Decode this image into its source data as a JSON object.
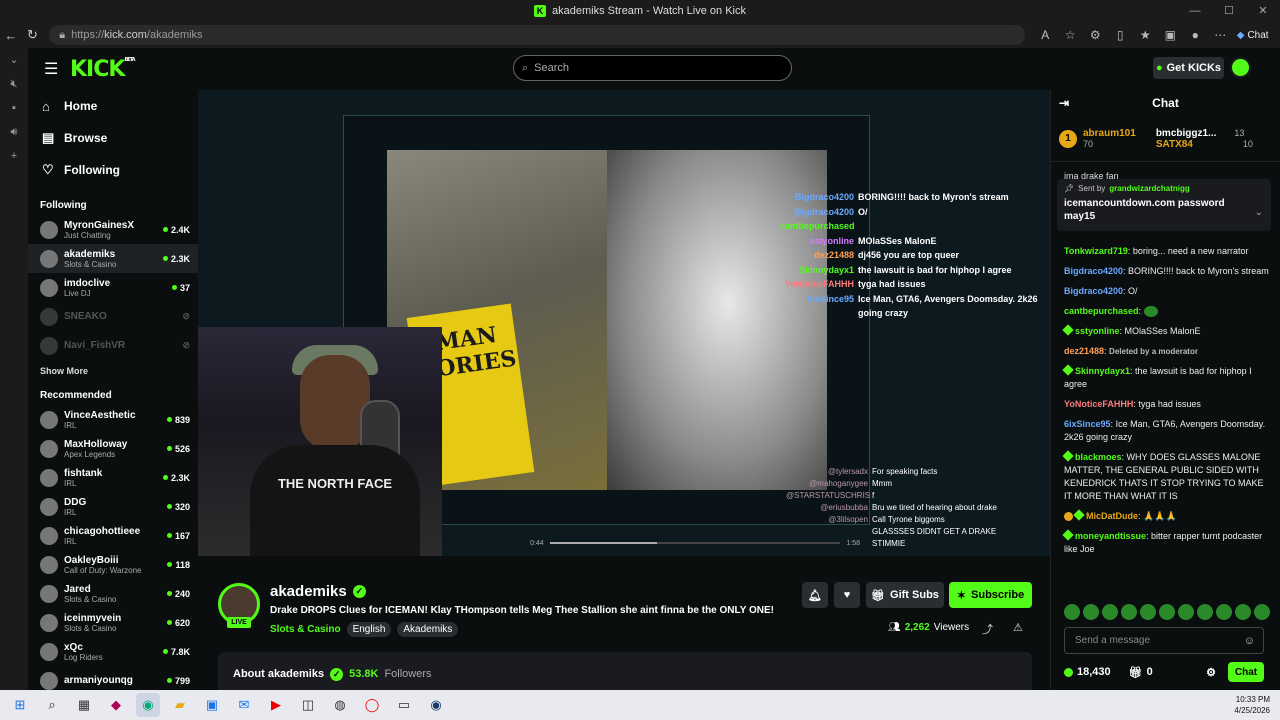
{
  "window": {
    "title": "akademiks Stream - Watch Live on Kick"
  },
  "browser": {
    "url_prefix": "https://",
    "url_domain": "kick.com",
    "url_path": "/akademiks",
    "copilot_label": "Chat"
  },
  "header": {
    "logo": "KICK",
    "logo_badge": "BETA",
    "search_placeholder": "Search",
    "get_kicks_label": "Get KICKs"
  },
  "sidebar": {
    "nav": [
      {
        "label": "Home",
        "icon": "home-icon"
      },
      {
        "label": "Browse",
        "icon": "browse-icon"
      },
      {
        "label": "Following",
        "icon": "heart-icon"
      }
    ],
    "following_title": "Following",
    "following": [
      {
        "name": "MyronGainesX",
        "category": "Just Chatting",
        "viewers": "2.4K",
        "live": true
      },
      {
        "name": "akademiks",
        "category": "Slots & Casino",
        "viewers": "2.3K",
        "live": true
      },
      {
        "name": "imdoclive",
        "category": "Live DJ",
        "viewers": "37",
        "live": true
      },
      {
        "name": "SNEAKO",
        "category": "",
        "viewers": "",
        "live": false
      },
      {
        "name": "Navi_FishVR",
        "category": "",
        "viewers": "",
        "live": false
      }
    ],
    "show_more": "Show More",
    "recommended_title": "Recommended",
    "recommended": [
      {
        "name": "VinceAesthetic",
        "category": "IRL",
        "viewers": "839"
      },
      {
        "name": "MaxHolloway",
        "category": "Apex Legends",
        "viewers": "526"
      },
      {
        "name": "fishtank",
        "category": "IRL",
        "viewers": "2.3K"
      },
      {
        "name": "DDG",
        "category": "IRL",
        "viewers": "320"
      },
      {
        "name": "chicagohottieee",
        "category": "IRL",
        "viewers": "167"
      },
      {
        "name": "OakleyBoiii",
        "category": "Call of Duty: Warzone",
        "viewers": "118"
      },
      {
        "name": "Jared",
        "category": "Slots & Casino",
        "viewers": "240"
      },
      {
        "name": "iceinmyvein",
        "category": "Slots & Casino",
        "viewers": "620"
      },
      {
        "name": "xQc",
        "category": "Log Riders",
        "viewers": "7.8K"
      },
      {
        "name": "armaniyounqg",
        "category": "",
        "viewers": "799"
      }
    ]
  },
  "player": {
    "book_text": "UMAN TORIES",
    "shirt_text": "THE NORTH FACE",
    "overlay_chat": [
      {
        "user": "Bigdraco4200",
        "msg": "BORING!!!! back to Myron's stream",
        "color": "#6aa9ff"
      },
      {
        "user": "Bigdraco4200",
        "msg": "O/",
        "color": "#6aa9ff"
      },
      {
        "user": "cantbepurchased",
        "msg": "",
        "color": "#53fc18"
      },
      {
        "user": "sstyonline",
        "msg": "MOlaSSes MalonE",
        "color": "#d77aff"
      },
      {
        "user": "dez21488",
        "msg": "dj456 you are top queer",
        "color": "#ffa057"
      },
      {
        "user": "Skinnydayx1",
        "msg": "the lawsuit is bad for hiphop I agree",
        "color": "#53fc18"
      },
      {
        "user": "YoNoticeFAHHH",
        "msg": "tyga had issues",
        "color": "#ff7a7a"
      },
      {
        "user": "6ixSince95",
        "msg": "Ice Man, GTA6, Avengers Doomsday. 2k26 going crazy",
        "color": "#6aa9ff"
      }
    ],
    "overlay_chat2": [
      {
        "user": "@tylersadx",
        "msg": "For speaking facts"
      },
      {
        "user": "@mahoganygee",
        "msg": "Mmm"
      },
      {
        "user": "@STARSTATUSCHRIS",
        "msg": "f"
      },
      {
        "user": "@eriusbubba",
        "msg": "Bru we tired of hearing about drake"
      },
      {
        "user": "@3lilsopen",
        "msg": "Call Tyrone biggoms"
      },
      {
        "user": "",
        "msg": "GLASSSES DIDNT GET A DRAKE STIMMIE"
      }
    ],
    "time_current": "0:44",
    "time_total": "1:58",
    "progress": 0.37
  },
  "stream": {
    "name": "akademiks",
    "live_label": "LIVE",
    "title": "Drake DROPS Clues for ICEMAN! Klay THompson tells Meg Thee Stallion she aint finna be the ONLY ONE!",
    "category": "Slots & Casino",
    "tags": [
      "English",
      "Akademiks"
    ],
    "viewers": "2,262",
    "viewers_label": "Viewers",
    "gift_subs_label": "Gift Subs",
    "subscribe_label": "Subscribe",
    "about_label": "About akademiks",
    "followers": "53.8K",
    "followers_label": "Followers"
  },
  "chat": {
    "title": "Chat",
    "leaderboard": [
      {
        "name": "abraum101",
        "score": "70"
      },
      {
        "name": "bmcbiggz1...",
        "score": "13"
      },
      {
        "name": "SATX84",
        "score": "10"
      }
    ],
    "behind_pinned": "ima drake fan",
    "pinned_by_prefix": "Sent by",
    "pinned_by": "grandwizardchatnigg",
    "pinned_msg": "icemancountdown.com password may15",
    "messages": [
      {
        "user": "Tonkwizard719",
        "color": "#53fc18",
        "text": "boring... need a new narrator"
      },
      {
        "user": "Bigdraco4200",
        "color": "#6aa9ff",
        "text": "BORING!!!! back to Myron's stream"
      },
      {
        "user": "Bigdraco4200",
        "color": "#6aa9ff",
        "text": "O/"
      },
      {
        "user": "cantbepurchased",
        "color": "#53fc18",
        "text": ""
      },
      {
        "user": "sstyonline",
        "color": "#53fc18",
        "text": "MOlaSSes MalonE"
      },
      {
        "user": "dez21488",
        "color": "#ffa057",
        "text": "Deleted by a moderator"
      },
      {
        "user": "Skinnydayx1",
        "color": "#53fc18",
        "text": "the lawsuit is bad for hiphop I agree"
      },
      {
        "user": "YoNoticeFAHHH",
        "color": "#ff7a7a",
        "text": "tyga had issues"
      },
      {
        "user": "6ixSince95",
        "color": "#6aa9ff",
        "text": "Ice Man, GTA6, Avengers Doomsday. 2k26 going crazy"
      },
      {
        "user": "blackmoes",
        "color": "#53fc18",
        "text": "WHY DOES GLASSES MALONE MATTER, THE GENERAL PUBLIC SIDED WITH KENEDRICK THATS IT STOP TRYING TO MAKE IT MORE THAN WHAT IT IS"
      },
      {
        "user": "MicDatDude",
        "color": "#e6a817",
        "text": "🙏🙏🙏"
      },
      {
        "user": "moneyandtissue",
        "color": "#53fc18",
        "text": "bitter rapper turnt podcaster like Joe"
      }
    ],
    "send_placeholder": "Send a message",
    "points": "18,430",
    "gifts": "0",
    "chat_button": "Chat"
  },
  "taskbar": {
    "time": "10:33 PM",
    "date": "4/25/2026"
  }
}
